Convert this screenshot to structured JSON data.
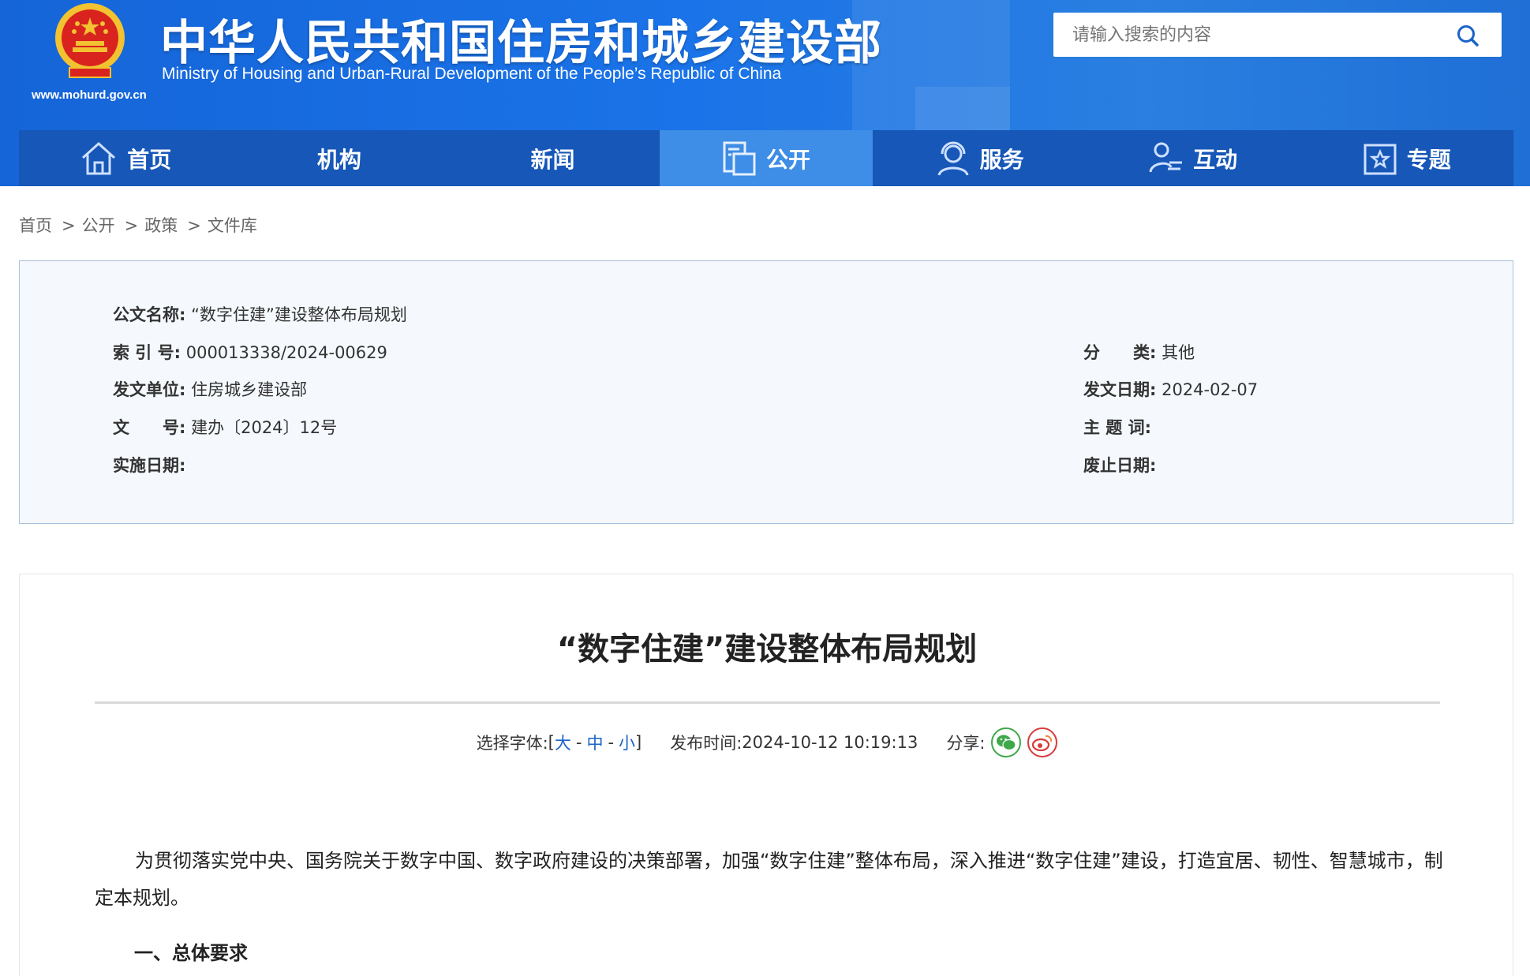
{
  "header": {
    "site_title": "中华人民共和国住房和城乡建设部",
    "site_subtitle": "Ministry of Housing and Urban-Rural Development of the People’s Republic of China",
    "site_url": "www.mohurd.gov.cn",
    "search_placeholder": "请输入搜索的内容",
    "colors": {
      "header_bg": "#1a73e8",
      "nav_bg": "#1657b8",
      "nav_active": "#3e8de6"
    }
  },
  "nav": {
    "items": [
      {
        "label": "首页",
        "icon": "home-icon"
      },
      {
        "label": "机构",
        "icon": ""
      },
      {
        "label": "新闻",
        "icon": ""
      },
      {
        "label": "公开",
        "icon": "document-icon",
        "active": true
      },
      {
        "label": "服务",
        "icon": "headset-user-icon"
      },
      {
        "label": "互动",
        "icon": "user-exchange-icon"
      },
      {
        "label": "专题",
        "icon": "star-box-icon"
      }
    ]
  },
  "breadcrumb": {
    "items": [
      "首页",
      "公开",
      "政策",
      "文件库"
    ],
    "separator": ">"
  },
  "info": {
    "doc_name_label": "公文名称:",
    "doc_name_value": "“数字住建”建设整体布局规划",
    "index_label": "索 引 号:",
    "index_value": "000013338/2024-00629",
    "category_label": "分　　类:",
    "category_value": "其他",
    "issuer_label": "发文单位:",
    "issuer_value": "住房城乡建设部",
    "issue_date_label": "发文日期:",
    "issue_date_value": "2024-02-07",
    "doc_no_label": "文　　号:",
    "doc_no_value": "建办〔2024〕12号",
    "keywords_label": "主 题 词:",
    "keywords_value": "",
    "effective_label": "实施日期:",
    "effective_value": "",
    "expiry_label": "废止日期:",
    "expiry_value": ""
  },
  "article": {
    "title": "“数字住建”建设整体布局规划",
    "font_label": "选择字体:",
    "font_open": "[",
    "font_large": "大",
    "font_medium": "中",
    "font_small": "小",
    "font_dash": "-",
    "font_close": "]",
    "publish_label": "发布时间:",
    "publish_time": "2024-10-12 10:19:13",
    "share_label": "分享:",
    "share_icons": [
      "wechat-icon",
      "weibo-icon"
    ],
    "paragraph": "为贯彻落实党中央、国务院关于数字中国、数字政府建设的决策部署，加强“数字住建”整体布局，深入推进“数字住建”建设，打造宜居、韧性、智慧城市，制定本规划。",
    "section_heading": "一、总体要求"
  }
}
